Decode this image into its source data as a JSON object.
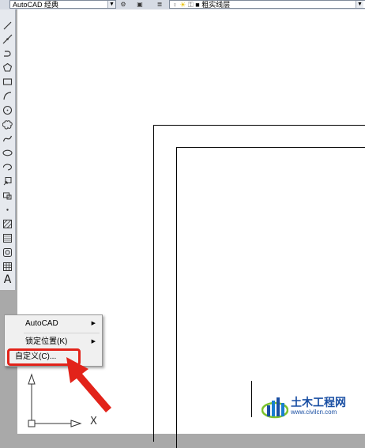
{
  "toolbar": {
    "workspace_value": "AutoCAD 经典",
    "layer_value": "粗实线层"
  },
  "context_menu": {
    "items": [
      {
        "label": "AutoCAD",
        "has_submenu": true
      },
      {
        "label": "锁定位置(K)",
        "has_submenu": true
      },
      {
        "label": "自定义(C)...",
        "has_submenu": false
      }
    ]
  },
  "ucs": {
    "x_label": "X"
  },
  "watermark": {
    "name": "土木工程网",
    "url": "www.civilcn.com"
  },
  "colors": {
    "highlight": "#e2231a",
    "accent_blue": "#1a4fa3"
  }
}
